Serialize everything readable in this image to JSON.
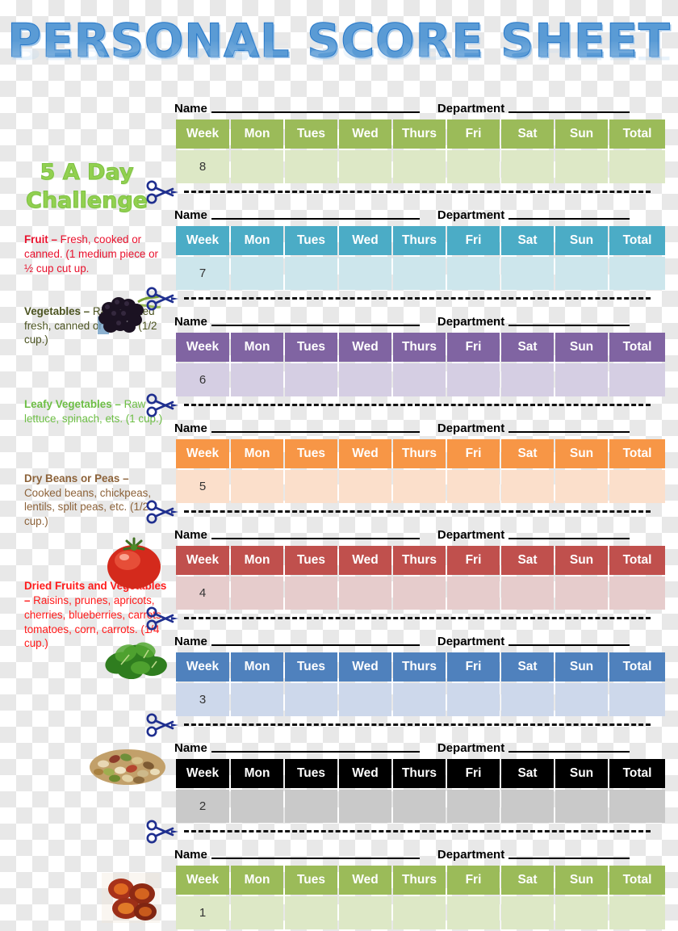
{
  "title": {
    "text": "PERSONAL SCORE SHEET"
  },
  "challenge": {
    "line1": "5 A Day",
    "line2": "Challenge"
  },
  "food_groups": [
    {
      "name": "Fruit",
      "label": "Fruit – ",
      "description": "Fresh, cooked or canned. (1 medium piece or ½ cup cut up.",
      "color": "#E8112D",
      "image": "blackberry-photo"
    },
    {
      "name": "Vegetables",
      "label": "Vegetables – ",
      "description": "Raw, cooked fresh, canned or frozen (1/2 cup.)",
      "color": "#4B5320",
      "image": "tomato-photo"
    },
    {
      "name": "Leafy Vegetables",
      "label": "Leafy Vegetables – ",
      "description": "Raw lettuce, spinach, ets. (1 cup.)",
      "color": "#6DBE45",
      "image": "spinach-photo"
    },
    {
      "name": "Dry Beans or Peas",
      "label": "Dry Beans or Peas – ",
      "description": "Cooked beans, chickpeas, lentils, split peas, etc. (1/2 cup.)",
      "color": "#8C6239",
      "image": "beans-photo"
    },
    {
      "name": "Dried Fruits and Vegetables",
      "label": "Dried Fruits and Vegetables – ",
      "description": "Raisins, prunes, apricots, cherries, blueberries, carrots, tomatoes, corn, carrots. (1/4 cup.)",
      "color": "#FF1A1A",
      "image": "dried-tomatoes-photo"
    }
  ],
  "form": {
    "name_label": "Name",
    "department_label": "Department"
  },
  "table": {
    "columns": [
      "Week",
      "Mon",
      "Tues",
      "Wed",
      "Thurs",
      "Fri",
      "Sat",
      "Sun",
      "Total"
    ]
  },
  "sheets": [
    {
      "week": "8",
      "header_color": "#9BBB59",
      "row_color": "#DDE8C6"
    },
    {
      "week": "7",
      "header_color": "#4BACC6",
      "row_color": "#CDE6EC"
    },
    {
      "week": "6",
      "header_color": "#8064A2",
      "row_color": "#D5CEE3"
    },
    {
      "week": "5",
      "header_color": "#F79646",
      "row_color": "#FBDFCB"
    },
    {
      "week": "4",
      "header_color": "#C0504D",
      "row_color": "#E6CCCC"
    },
    {
      "week": "3",
      "header_color": "#4F81BD",
      "row_color": "#CDD8EB"
    },
    {
      "week": "2",
      "header_color": "#000000",
      "row_color": "#C9C9C9"
    },
    {
      "week": "1",
      "header_color": "#9BBB59",
      "row_color": "#DDE8C6"
    }
  ],
  "icons": {
    "scissors": "scissors-icon"
  }
}
